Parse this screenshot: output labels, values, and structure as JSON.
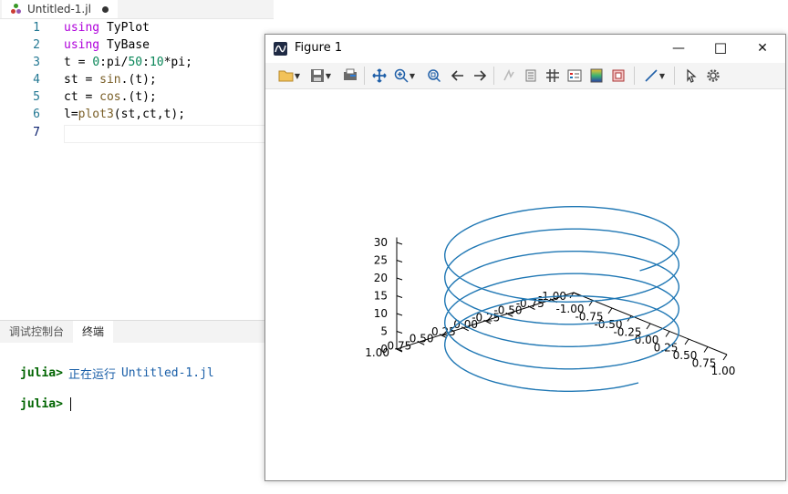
{
  "editor": {
    "tab_name": "Untitled-1.jl",
    "line_numbers": [
      "1",
      "2",
      "3",
      "4",
      "5",
      "6",
      "7"
    ],
    "code": {
      "l1_kw": "using",
      "l1_rest": " TyPlot",
      "l2_kw": "using",
      "l2_rest": " TyBase",
      "l3_a": "t = ",
      "l3_b": "0",
      "l3_c": ":pi/",
      "l3_d": "50",
      "l3_e": ":",
      "l3_f": "10",
      "l3_g": "*pi;",
      "l4_a": "st = ",
      "l4_b": "sin",
      "l4_c": ".(t);",
      "l5_a": "ct = ",
      "l5_b": "cos",
      "l5_c": ".(t);",
      "l6_a": "l=",
      "l6_b": "plot3",
      "l6_c": "(st,ct,t);"
    }
  },
  "panel": {
    "tab_debug": "调试控制台",
    "tab_terminal": "终端",
    "prompt": "julia>",
    "running_text": "正在运行",
    "running_file": "Untitled-1.jl"
  },
  "figure": {
    "title": "Figure 1",
    "min_glyph": "—",
    "max_glyph": "☐",
    "close_glyph": "✕",
    "toolbar_icons": [
      "open-icon",
      "save-icon",
      "export-icon",
      "pan-icon",
      "zoom-in-icon",
      "zoom-fit-icon",
      "back-icon",
      "forward-icon",
      "brush-icon",
      "colorbar-icon",
      "grid-icon",
      "legend-icon",
      "colormap-icon",
      "box-icon",
      "line-style-icon",
      "pointer-icon",
      "settings-icon"
    ],
    "z_ticks": [
      "30",
      "25",
      "20",
      "15",
      "10",
      "5",
      "0"
    ],
    "x_ticks": [
      "1.00",
      "0.75",
      "0.50",
      "0.25",
      "0.00",
      "-0.25",
      "-0.50",
      "-0.75",
      "-1.00"
    ],
    "y_ticks": [
      "-1.00",
      "-0.75",
      "-0.50",
      "-0.25",
      "0.00",
      "0.25",
      "0.50",
      "0.75",
      "1.00"
    ]
  },
  "chart_data": {
    "type": "line",
    "series": [
      {
        "x_expr": "sin(t)",
        "y_expr": "cos(t)",
        "z_expr": "t",
        "t_range": [
          0,
          31.4159
        ],
        "t_step": 0.0628,
        "color": "#1f77b4"
      }
    ],
    "zlim": [
      0,
      31.4159
    ],
    "xlim": [
      -1,
      1
    ],
    "ylim": [
      -1,
      1
    ]
  }
}
